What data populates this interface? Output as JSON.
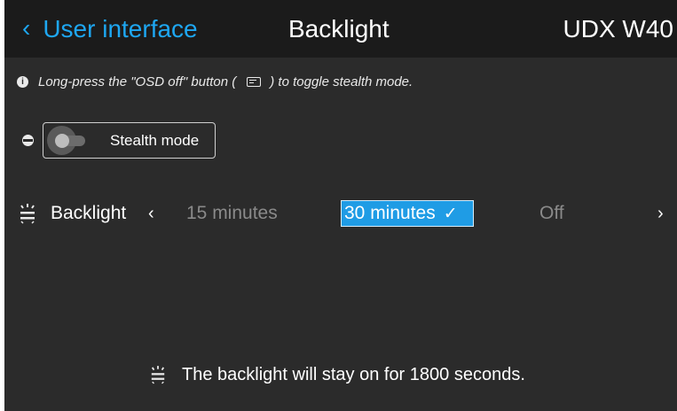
{
  "header": {
    "back_label": "User interface",
    "title": "Backlight",
    "model": "UDX W40"
  },
  "info": {
    "text_before": "Long-press the \"OSD off\" button (",
    "text_after": ") to toggle stealth mode."
  },
  "stealth": {
    "label": "Stealth mode",
    "enabled": false
  },
  "backlight": {
    "label": "Backlight",
    "options": [
      "15 minutes",
      "30 minutes",
      "Off"
    ],
    "selected": "30 minutes"
  },
  "footer": {
    "text": "The backlight will stay on for 1800 seconds."
  },
  "colors": {
    "accent": "#1ea7f2",
    "selected_bg": "#1f9ce5",
    "background": "#2b2b2b",
    "topbar": "#1b1b1b"
  }
}
